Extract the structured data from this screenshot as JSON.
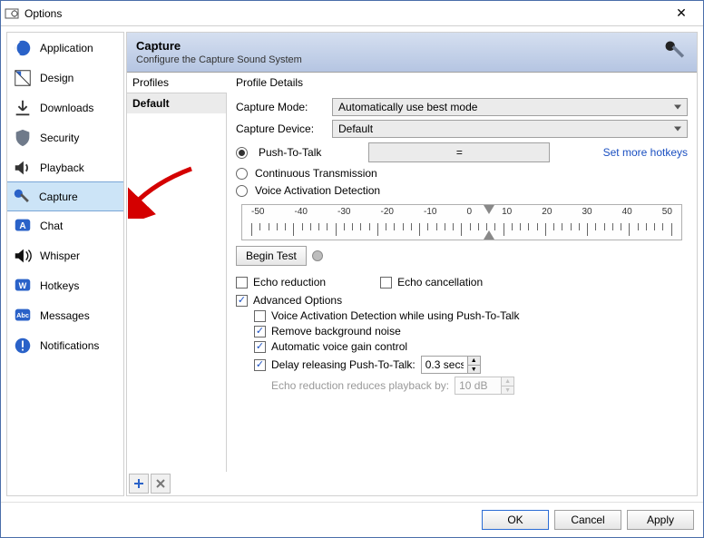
{
  "window": {
    "title": "Options"
  },
  "sidebar": {
    "items": [
      {
        "label": "Application"
      },
      {
        "label": "Design"
      },
      {
        "label": "Downloads"
      },
      {
        "label": "Security"
      },
      {
        "label": "Playback"
      },
      {
        "label": "Capture"
      },
      {
        "label": "Chat"
      },
      {
        "label": "Whisper"
      },
      {
        "label": "Hotkeys"
      },
      {
        "label": "Messages"
      },
      {
        "label": "Notifications"
      }
    ],
    "selected_index": 5
  },
  "header": {
    "title": "Capture",
    "subtitle": "Configure the Capture Sound System"
  },
  "profiles": {
    "label": "Profiles",
    "items": [
      "Default"
    ],
    "selected": 0
  },
  "details": {
    "heading": "Profile Details",
    "capture_mode": {
      "label": "Capture Mode:",
      "value": "Automatically use best mode"
    },
    "capture_device": {
      "label": "Capture Device:",
      "value": "Default"
    },
    "modes": {
      "ptt": {
        "label": "Push-To-Talk",
        "hotkey": "=",
        "more_link": "Set more hotkeys"
      },
      "ct": {
        "label": "Continuous Transmission"
      },
      "vad": {
        "label": "Voice Activation Detection"
      },
      "selected": "ptt"
    },
    "ruler_labels": [
      "-50",
      "-40",
      "-30",
      "-20",
      "-10",
      "0",
      "10",
      "20",
      "30",
      "40",
      "50"
    ],
    "begin_test": "Begin Test",
    "echo_reduction": {
      "label": "Echo reduction",
      "checked": false
    },
    "echo_cancellation": {
      "label": "Echo cancellation",
      "checked": false
    },
    "advanced": {
      "label": "Advanced Options",
      "checked": true,
      "vad_ptt": {
        "label": "Voice Activation Detection while using Push-To-Talk",
        "checked": false
      },
      "remove_noise": {
        "label": "Remove background noise",
        "checked": true
      },
      "agc": {
        "label": "Automatic voice gain control",
        "checked": true
      },
      "delay_ptt": {
        "label": "Delay releasing Push-To-Talk:",
        "checked": true,
        "value": "0.3 secs"
      },
      "echo_playback": {
        "label": "Echo reduction reduces playback by:",
        "value": "10 dB"
      }
    }
  },
  "buttons": {
    "ok": "OK",
    "cancel": "Cancel",
    "apply": "Apply"
  }
}
